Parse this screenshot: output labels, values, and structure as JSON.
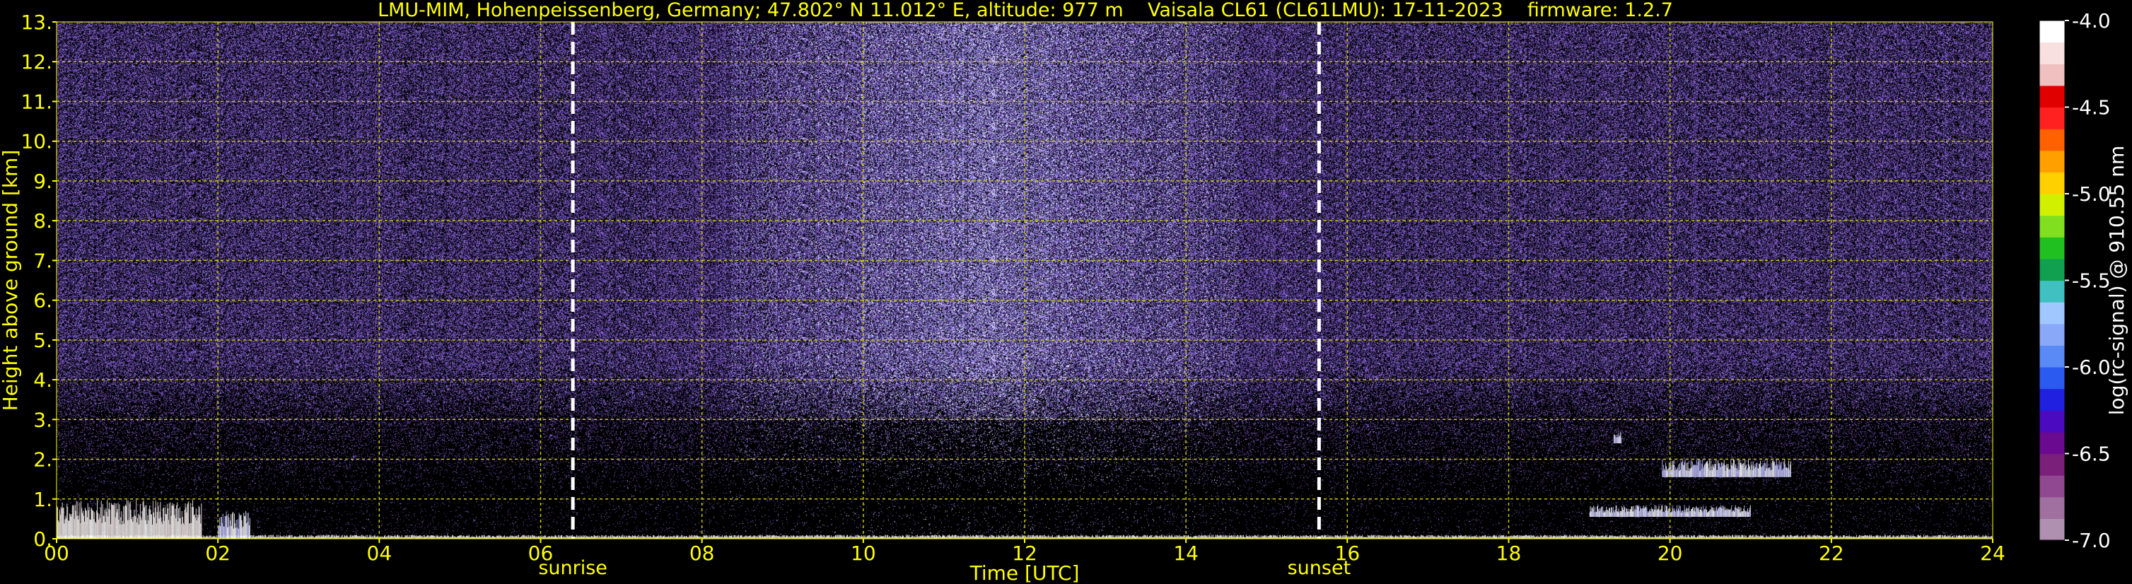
{
  "chart_data": {
    "type": "heatmap",
    "title": {
      "station": "LMU-MIM, Hohenpeissenberg, Germany; 47.802° N 11.012° E, altitude: 977 m",
      "instrument": "Vaisala CL61 (CL61LMU): 17-11-2023",
      "firmware": "firmware: 1.2.7"
    },
    "xlabel": "Time [UTC]",
    "ylabel": "Height above ground [km]",
    "xlim": [
      0,
      24
    ],
    "ylim": [
      0,
      13
    ],
    "x_tick_labels": [
      "00",
      "02",
      "04",
      "06",
      "08",
      "10",
      "12",
      "14",
      "16",
      "18",
      "20",
      "22",
      "24"
    ],
    "y_tick_labels": [
      "0.",
      "1.",
      "2.",
      "3.",
      "4.",
      "5.",
      "6.",
      "7.",
      "8.",
      "9.",
      "10.",
      "11.",
      "12.",
      "13."
    ],
    "grid": true,
    "markers": [
      {
        "label": "sunrise",
        "time": 6.4
      },
      {
        "label": "sunset",
        "time": 15.65
      }
    ],
    "colorbar": {
      "label": "log(rc-signal) @ 910.55 nm",
      "range": [
        -7.0,
        -4.0
      ],
      "tick_labels": [
        "-4.0",
        "-4.5",
        "-5.0",
        "-5.5",
        "-6.0",
        "-6.5",
        "-7.0"
      ],
      "tick_values": [
        -4.0,
        -4.5,
        -5.0,
        -5.5,
        -6.0,
        -6.5,
        -7.0
      ],
      "colors_bottom_to_top": [
        "#b090b0",
        "#a070a0",
        "#904890",
        "#7a1f7a",
        "#6a0a90",
        "#4b0ac0",
        "#2020e0",
        "#2a5af0",
        "#5a8af5",
        "#8aa8f8",
        "#a0c8ff",
        "#40c0c0",
        "#10a050",
        "#20c020",
        "#80e020",
        "#d0f000",
        "#ffd000",
        "#ffa000",
        "#ff6000",
        "#ff2020",
        "#e00000",
        "#f0c0c0",
        "#f8e0e0",
        "#ffffff"
      ]
    },
    "features": [
      {
        "name": "boundary-layer",
        "t_start": 0,
        "t_end": 24,
        "h_top": 0.1,
        "level": -4.3
      },
      {
        "name": "morning-low-cloud",
        "t_start": 0,
        "t_end": 1.8,
        "h_top": 1.0,
        "level": -4.6
      },
      {
        "name": "morning-low-cloud-2",
        "t_start": 2.0,
        "t_end": 2.4,
        "h_top": 0.7,
        "level": -5.0
      },
      {
        "name": "evening-layer-1",
        "t_start": 19.0,
        "t_end": 21.0,
        "h_bottom": 0.55,
        "h_top": 0.85,
        "level": -5.8
      },
      {
        "name": "evening-layer-2",
        "t_start": 19.9,
        "t_end": 21.5,
        "h_bottom": 1.55,
        "h_top": 2.0,
        "level": -5.6
      },
      {
        "name": "evening-layer-3",
        "t_start": 19.3,
        "t_end": 19.4,
        "h_bottom": 2.4,
        "h_top": 2.7,
        "level": -6.2
      }
    ],
    "noise_colors": [
      "#6a3fa8",
      "#7a4ec0",
      "#5a48b8",
      "#8a60c8",
      "#9a88e0",
      "#4a3a90",
      "#b0a0f0",
      "#7a90d8",
      "#c0c0ff",
      "#ffffff"
    ]
  }
}
